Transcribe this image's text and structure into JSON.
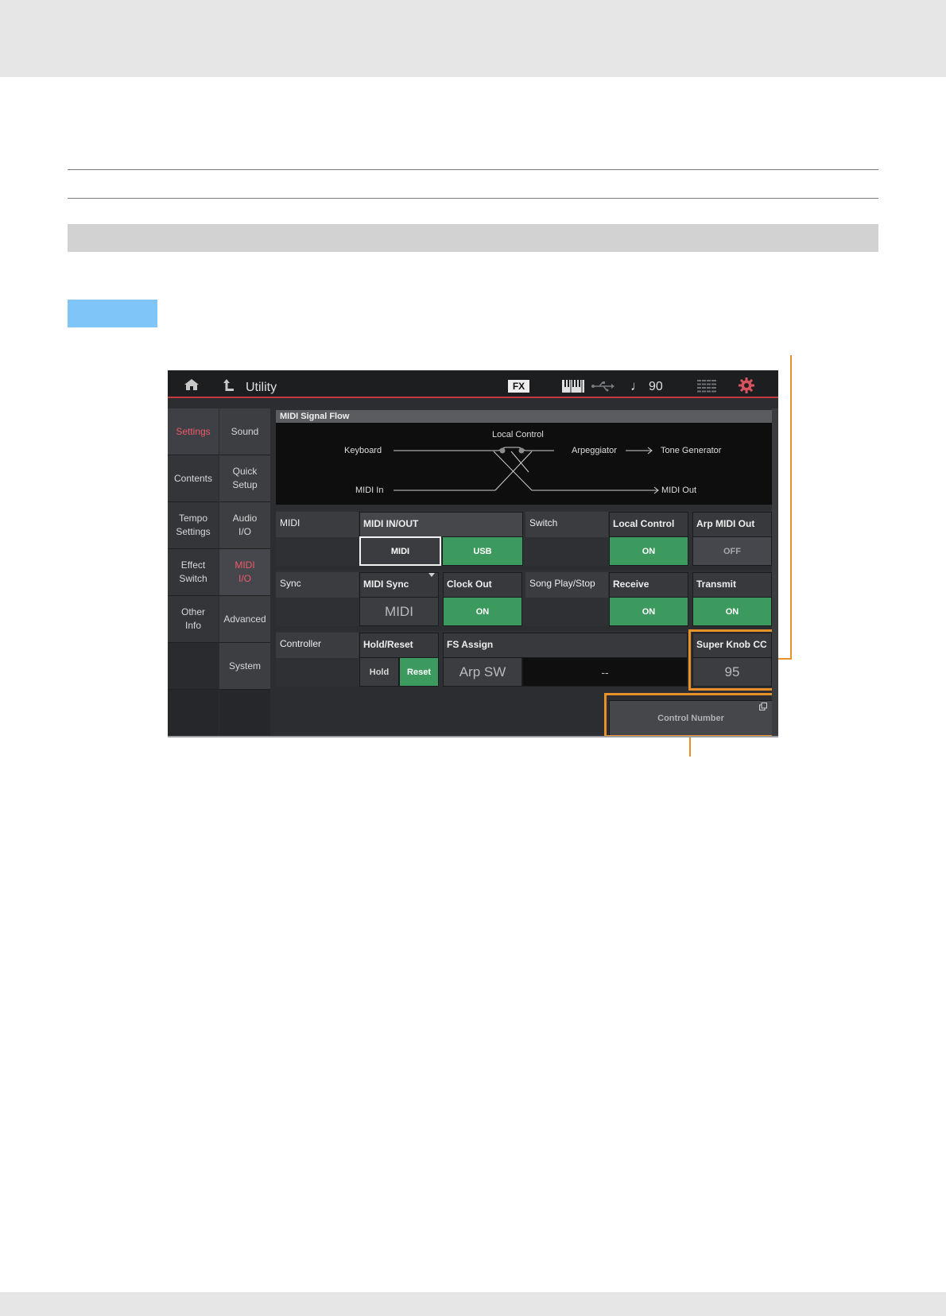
{
  "header": {
    "title": "Utility",
    "fx_badge": "FX",
    "note_symbol": "♩",
    "tempo": "90"
  },
  "nav": {
    "col1": [
      "Settings",
      "Contents",
      "Tempo\nSettings",
      "Effect\nSwitch",
      "Other\nInfo"
    ],
    "col2": [
      "Sound",
      "Quick\nSetup",
      "Audio\nI/O",
      "MIDI\nI/O",
      "Advanced",
      "System"
    ]
  },
  "flow": {
    "title": "MIDI Signal Flow",
    "local_control": "Local Control",
    "keyboard": "Keyboard",
    "arpeggiator": "Arpeggiator",
    "tone_generator": "Tone Generator",
    "midi_in": "MIDI In",
    "midi_out": "MIDI Out"
  },
  "midi": {
    "label": "MIDI",
    "in_out_label": "MIDI IN/OUT",
    "midi_btn": "MIDI",
    "usb_btn": "USB",
    "switch_label": "Switch",
    "local_control_label": "Local Control",
    "local_control_value": "ON",
    "arp_midi_out_label": "Arp MIDI Out",
    "arp_midi_out_value": "OFF"
  },
  "sync": {
    "label": "Sync",
    "midi_sync_label": "MIDI Sync",
    "midi_sync_value": "MIDI",
    "clock_out_label": "Clock Out",
    "clock_out_value": "ON",
    "song_label": "Song Play/Stop",
    "receive_label": "Receive",
    "receive_value": "ON",
    "transmit_label": "Transmit",
    "transmit_value": "ON"
  },
  "controller": {
    "label": "Controller",
    "hold_reset_label": "Hold/Reset",
    "hold_btn": "Hold",
    "reset_btn": "Reset",
    "fs_assign_label": "FS Assign",
    "fs_assign_value": "Arp SW",
    "fs_assign_cc": "--",
    "super_knob_label": "Super Knob CC",
    "super_knob_value": "95"
  },
  "control_number": "Control Number"
}
